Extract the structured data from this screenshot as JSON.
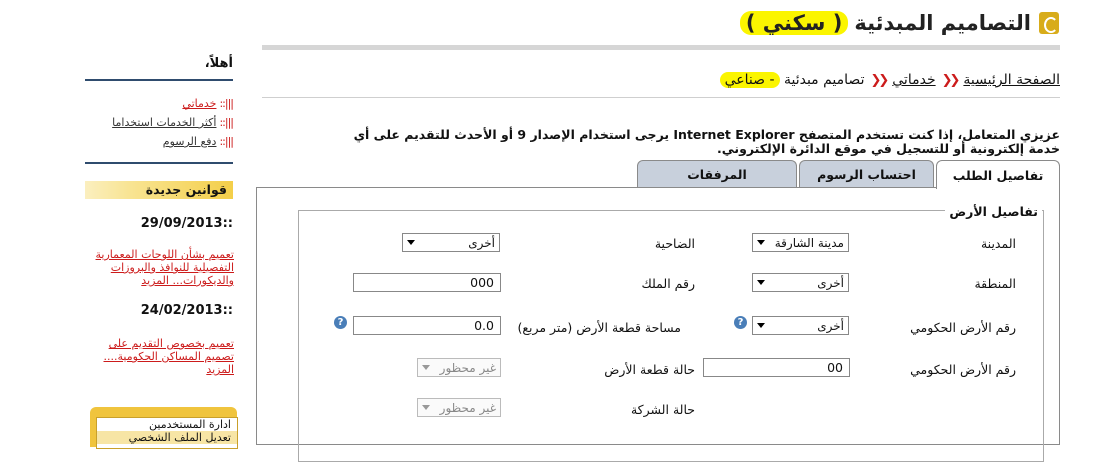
{
  "header": {
    "title": "التصاميم المبدئية",
    "highlight": "( سكني )"
  },
  "breadcrumb": {
    "home": "الصفحة الرئيسية",
    "services": "خدماتي",
    "current_prefix": "تصاميم مبدئية",
    "current_highlight": "- صناعي"
  },
  "notice": "عزيزي المتعامل، إذا كنت تستخدم المتصفح Internet Explorer يرجى استخدام الإصدار 9 أو الأحدث للتقديم على أي خدمة إلكترونية أو للتسجيل في موقع الدائرة الإلكتروني.",
  "tabs": [
    {
      "label": "تفاصيل الطلب",
      "active": true
    },
    {
      "label": "احتساب الرسوم",
      "active": false
    },
    {
      "label": "المرفقات",
      "active": false
    }
  ],
  "form": {
    "legend": "تفاصيل الأرض",
    "city": {
      "label": "المدينة",
      "value": "مدينة الشارقة"
    },
    "suburb": {
      "label": "الضاحية",
      "value": "أخرى"
    },
    "area": {
      "label": "المنطقة",
      "value": "أخرى"
    },
    "owner_no": {
      "label": "رقم الملك",
      "value": "000"
    },
    "gov_land_no_select": {
      "label": "رقم الأرض الحكومي",
      "value": "أخرى"
    },
    "plot_area": {
      "label": "مساحة قطعة الأرض (متر مربع)",
      "value": "0.0"
    },
    "gov_land_no": {
      "label": "رقم الأرض الحكومي",
      "value": "00"
    },
    "plot_status": {
      "label": "حالة قطعة الأرض",
      "value": "غير محظور"
    },
    "company_status": {
      "label": "حالة الشركة",
      "value": "غير محظور"
    },
    "help_symbol": "?"
  },
  "sidebar": {
    "greeting": "أهلاً،",
    "links": [
      {
        "mark": "|||::",
        "label": "خدماتي",
        "active": true
      },
      {
        "mark": "|||::",
        "label": "أكثر الخدمات استخداما",
        "active": false
      },
      {
        "mark": "|||::",
        "label": "دفع الرسوم",
        "active": false
      }
    ],
    "laws_header": "قوانين جديدة",
    "news": [
      {
        "date": "29/09/2013::",
        "text": "تعميم بشأن اللوحات المعمارية التفصيلية للنوافذ والبروزات والديكورات... المزيد"
      },
      {
        "date": "24/02/2013::",
        "text": "تعميم بخصوص التقديم على تصميم المساكن الحكومية.... المزيد"
      }
    ],
    "admin": {
      "title": "ادارة المستخدمين",
      "item": "تعديل الملف الشخصي"
    }
  },
  "colors": {
    "highlight": "#fbf500",
    "accent_red": "#cc1b1b",
    "tab_inactive": "#c8d0dc",
    "gold": "#f0c43d"
  }
}
